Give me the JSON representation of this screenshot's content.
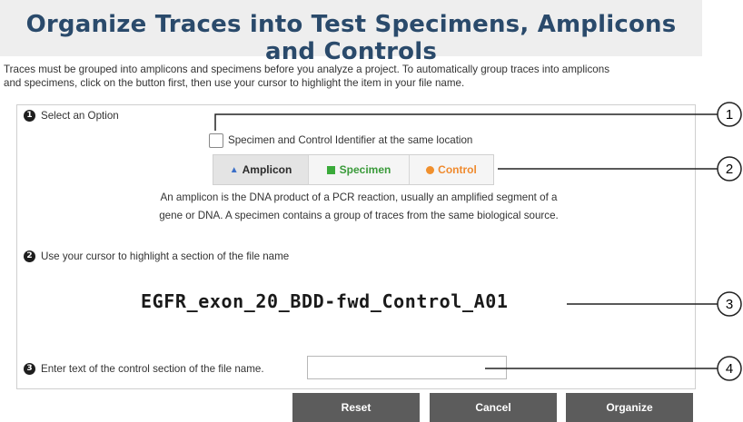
{
  "title": "Organize Traces into Test Specimens, Amplicons and Controls",
  "intro": {
    "line1": "Traces must be grouped into amplicons and specimens before you analyze a project. To automatically group traces into amplicons",
    "line2": "and specimens, click on the button first, then use your cursor to highlight the item in your file name."
  },
  "step1": {
    "number": "1",
    "label": "Select an Option"
  },
  "checkbox": {
    "label": "Specimen and Control Identifier at the same location",
    "checked": false
  },
  "options": [
    {
      "label": "Amplicon",
      "icon": "triangle-icon",
      "color": "#3b6fc8"
    },
    {
      "label": "Specimen",
      "icon": "square-icon",
      "color": "#3aaa3a"
    },
    {
      "label": "Control",
      "icon": "dot-icon",
      "color": "#f0902e"
    }
  ],
  "description": {
    "line1": "An amplicon is the DNA product of a PCR reaction, usually an amplified segment of a",
    "line2": "gene or DNA. A specimen contains a group of traces from the same biological source."
  },
  "step2": {
    "number": "2",
    "label": "Use your cursor to highlight a section of the file name"
  },
  "filename": "EGFR_exon_20_BDD-fwd_Control_A01",
  "step3": {
    "number": "3",
    "label": "Enter text of the control section of the file name."
  },
  "control_input": {
    "value": "",
    "placeholder": ""
  },
  "buttons": {
    "reset": "Reset",
    "cancel": "Cancel",
    "organize": "Organize"
  },
  "callouts": [
    "1",
    "2",
    "3",
    "4"
  ]
}
